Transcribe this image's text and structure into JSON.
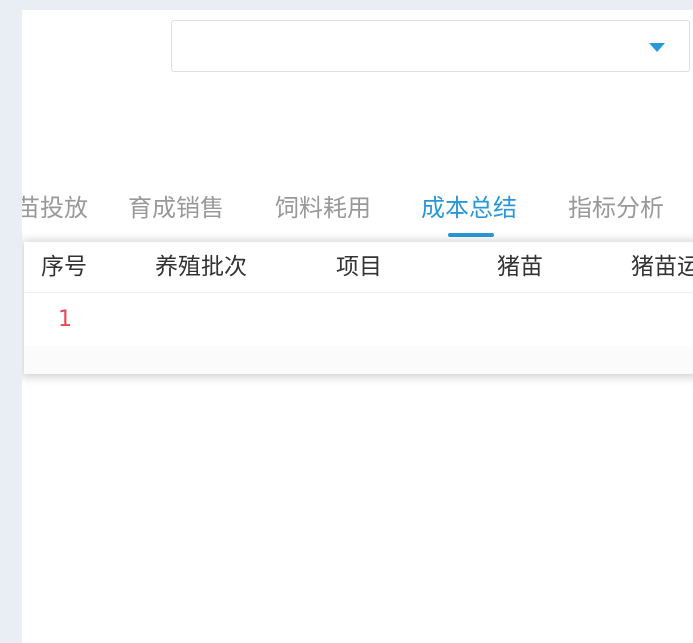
{
  "filter": {
    "selected_value": ""
  },
  "tabs": [
    {
      "label": "苗投放"
    },
    {
      "label": "育成销售"
    },
    {
      "label": "饲料耗用"
    },
    {
      "label": "成本总结",
      "active": true
    },
    {
      "label": "指标分析"
    }
  ],
  "table": {
    "headers": [
      "序号",
      "养殖批次",
      "项目",
      "猪苗",
      "猪苗运"
    ],
    "rows": [
      {
        "index": "1"
      }
    ]
  },
  "colors": {
    "accent": "#2a98d8",
    "index_text": "#e84855",
    "tab_inactive": "#999999"
  }
}
